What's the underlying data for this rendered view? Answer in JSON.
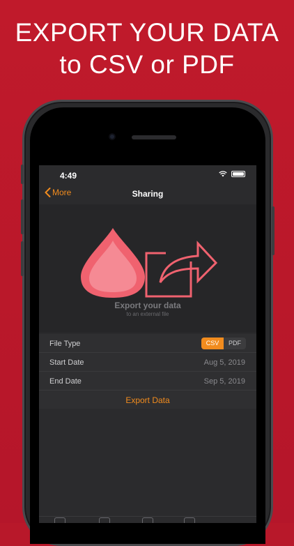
{
  "promo": {
    "headline_line1": "EXPORT YOUR DATA",
    "headline_line2": "to CSV or PDF"
  },
  "status_bar": {
    "time": "4:49",
    "icons": [
      "wifi-icon",
      "battery-icon"
    ]
  },
  "nav": {
    "back_label": "More",
    "title": "Sharing"
  },
  "hero": {
    "title": "Export your data",
    "subtitle": "to an external file",
    "icons": [
      "blood-drop-icon",
      "share-arrow-icon"
    ]
  },
  "rows": {
    "file_type": {
      "label": "File Type",
      "options": [
        "CSV",
        "PDF"
      ],
      "selected": "CSV"
    },
    "start_date": {
      "label": "Start Date",
      "value": "Aug 5, 2019"
    },
    "end_date": {
      "label": "End Date",
      "value": "Sep 5, 2019"
    },
    "export": {
      "label": "Export Data"
    }
  },
  "colors": {
    "background": "#b8182a",
    "accent": "#f28c1e",
    "drop": "#f0626f",
    "screen_bg": "#2b2b2d"
  }
}
